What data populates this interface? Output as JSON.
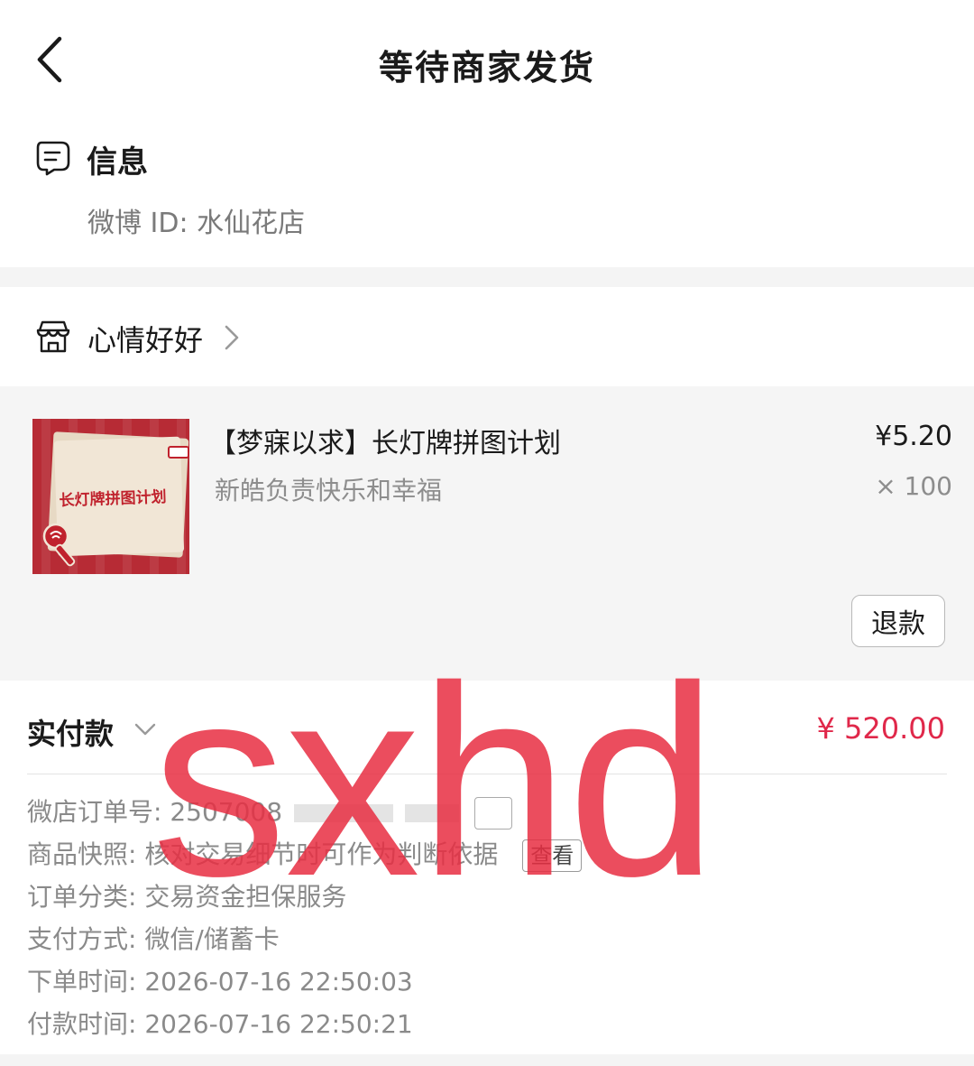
{
  "header": {
    "title": "等待商家发货",
    "back_icon": "chevron-left-icon"
  },
  "info": {
    "title": "信息",
    "icon": "message-icon",
    "weibo_id": "微博 ID: 水仙花店"
  },
  "shop": {
    "icon": "store-icon",
    "name": "心情好好"
  },
  "product": {
    "thumb_title": "长灯牌拼图计划",
    "name": "【梦寐以求】长灯牌拼图计划",
    "subtitle": "新皓负责快乐和幸福",
    "price": "¥5.20",
    "quantity": "× 100",
    "refund_label": "退款"
  },
  "payment": {
    "label": "实付款",
    "amount": "¥ 520.00",
    "accent_color": "#e0284a"
  },
  "details": {
    "order_no_label": "微店订单号:",
    "order_no_value": "2507008",
    "snapshot_label": "商品快照:",
    "snapshot_value": "核对交易细节时可作为判断依据",
    "snapshot_button": "查看",
    "category_label": "订单分类:",
    "category_value": "交易资金担保服务",
    "pay_method_label": "支付方式:",
    "pay_method_value": "微信/储蓄卡",
    "order_time_label": "下单时间:",
    "order_time_value": "2026-07-16 22:50:03",
    "pay_time_label": "付款时间:",
    "pay_time_value": "2026-07-16 22:50:21"
  },
  "watermark": {
    "text": "sxhd",
    "color": "#e82e42"
  }
}
